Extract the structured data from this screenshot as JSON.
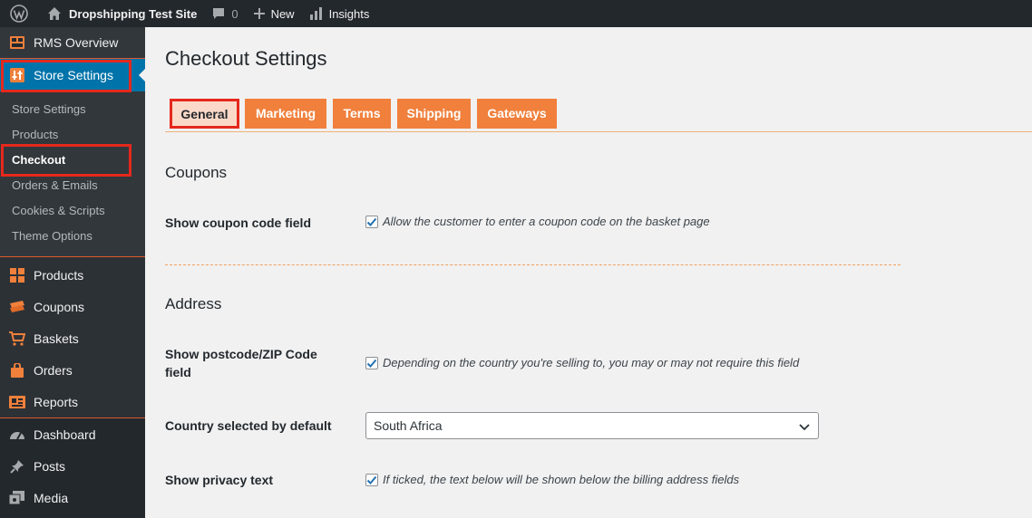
{
  "admin_bar": {
    "site_name": "Dropshipping Test Site",
    "comments_count": "0",
    "new_label": "New",
    "insights_label": "Insights"
  },
  "sidebar": {
    "rms_overview": "RMS Overview",
    "store_settings": "Store Settings",
    "submenu": [
      {
        "label": "Store Settings"
      },
      {
        "label": "Products"
      },
      {
        "label": "Checkout"
      },
      {
        "label": "Orders & Emails"
      },
      {
        "label": "Cookies & Scripts"
      },
      {
        "label": "Theme Options"
      }
    ],
    "group2": [
      {
        "label": "Products",
        "icon": "grid-icon"
      },
      {
        "label": "Coupons",
        "icon": "coupon-icon"
      },
      {
        "label": "Baskets",
        "icon": "cart-icon"
      },
      {
        "label": "Orders",
        "icon": "bag-icon"
      },
      {
        "label": "Reports",
        "icon": "report-icon"
      }
    ],
    "group3": [
      {
        "label": "Dashboard",
        "icon": "dashboard-icon"
      },
      {
        "label": "Posts",
        "icon": "pin-icon"
      },
      {
        "label": "Media",
        "icon": "media-icon"
      }
    ]
  },
  "main": {
    "title": "Checkout Settings",
    "tabs": [
      {
        "label": "General"
      },
      {
        "label": "Marketing"
      },
      {
        "label": "Terms"
      },
      {
        "label": "Shipping"
      },
      {
        "label": "Gateways"
      }
    ],
    "coupons": {
      "heading": "Coupons",
      "field_label": "Show coupon code field",
      "description": "Allow the customer to enter a coupon code on the basket page"
    },
    "address": {
      "heading": "Address",
      "postcode_label": "Show postcode/ZIP Code field",
      "postcode_description": "Depending on the country you're selling to, you may or may not require this field",
      "country_label": "Country selected by default",
      "country_value": "South Africa",
      "privacy_label": "Show privacy text",
      "privacy_description": "If ticked, the text below will be shown below the billing address fields"
    }
  },
  "colors": {
    "admin_dark": "#23282d",
    "accent_blue": "#0073aa",
    "tab_orange": "#f0803c",
    "highlight_red": "#e5281c"
  }
}
